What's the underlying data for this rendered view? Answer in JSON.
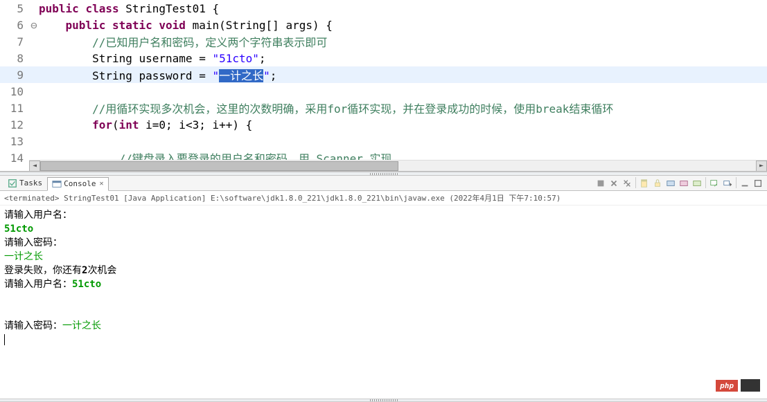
{
  "code": {
    "lines": [
      {
        "n": "5",
        "segs": [
          {
            "t": "public ",
            "c": "kw"
          },
          {
            "t": "class ",
            "c": "kw"
          },
          {
            "t": "StringTest01 {",
            "c": ""
          }
        ]
      },
      {
        "n": "6",
        "collapse": true,
        "segs": [
          {
            "t": "    ",
            "c": ""
          },
          {
            "t": "public ",
            "c": "kw"
          },
          {
            "t": "static ",
            "c": "kw"
          },
          {
            "t": "void ",
            "c": "kw"
          },
          {
            "t": "main(String[] args) {",
            "c": ""
          }
        ]
      },
      {
        "n": "7",
        "segs": [
          {
            "t": "        ",
            "c": ""
          },
          {
            "t": "//已知用户名和密码，定义两个字符串表示即可",
            "c": "cmt"
          }
        ]
      },
      {
        "n": "8",
        "segs": [
          {
            "t": "        String username = ",
            "c": ""
          },
          {
            "t": "\"51cto\"",
            "c": "str"
          },
          {
            "t": ";",
            "c": ""
          }
        ]
      },
      {
        "n": "9",
        "hl": true,
        "segs": [
          {
            "t": "        String password = ",
            "c": ""
          },
          {
            "t": "\"",
            "c": "str"
          },
          {
            "t": "一计之长",
            "c": "sel"
          },
          {
            "t": "\"",
            "c": "str"
          },
          {
            "t": ";",
            "c": ""
          }
        ]
      },
      {
        "n": "10",
        "segs": [
          {
            "t": "",
            "c": ""
          }
        ]
      },
      {
        "n": "11",
        "segs": [
          {
            "t": "        ",
            "c": ""
          },
          {
            "t": "//用循环实现多次机会，这里的次数明确，采用for循环实现，并在登录成功的时候，使用break结束循环",
            "c": "cmt"
          }
        ]
      },
      {
        "n": "12",
        "segs": [
          {
            "t": "        ",
            "c": ""
          },
          {
            "t": "for",
            "c": "kw"
          },
          {
            "t": "(",
            "c": ""
          },
          {
            "t": "int ",
            "c": "kw"
          },
          {
            "t": "i=0; i<3; i++) {",
            "c": ""
          }
        ]
      },
      {
        "n": "13",
        "segs": [
          {
            "t": "",
            "c": ""
          }
        ]
      },
      {
        "n": "14",
        "segs": [
          {
            "t": "            ",
            "c": ""
          },
          {
            "t": "//键盘录入要登录的用户名和密码，用 Scanner 实现",
            "c": "cmt"
          }
        ]
      }
    ]
  },
  "tabs": {
    "tasks": "Tasks",
    "console": "Console"
  },
  "status": "<terminated> StringTest01 [Java Application] E:\\software\\jdk1.8.0_221\\jdk1.8.0_221\\bin\\javaw.exe (2022年4月1日 下午7:10:57)",
  "console": [
    {
      "t": "请输入用户名：",
      "c": "out-black"
    },
    {
      "t": "51cto",
      "c": "out-green bold"
    },
    {
      "t": "请输入密码：",
      "c": "out-black"
    },
    {
      "t": "一计之长",
      "c": "out-green"
    },
    {
      "parts": [
        {
          "t": "登录失败，你还有",
          "c": "out-black"
        },
        {
          "t": "2",
          "c": "out-black out-bold"
        },
        {
          "t": "次机会",
          "c": "out-black"
        }
      ]
    },
    {
      "parts": [
        {
          "t": "请输入用户名：",
          "c": "out-black"
        },
        {
          "t": "51cto",
          "c": "out-green bold"
        }
      ]
    },
    {
      "t": "",
      "c": ""
    },
    {
      "t": "",
      "c": ""
    },
    {
      "parts": [
        {
          "t": "请输入密码：",
          "c": "out-black"
        },
        {
          "t": "一计之长",
          "c": "out-green"
        }
      ]
    }
  ],
  "watermark": "php"
}
